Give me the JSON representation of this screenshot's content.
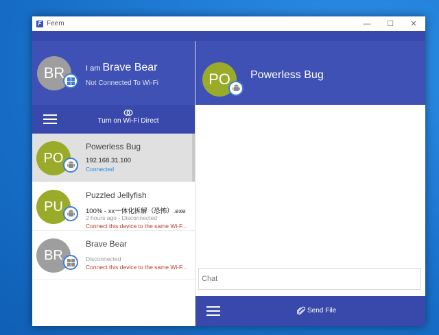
{
  "window": {
    "title": "Feem",
    "logo_letter": "F"
  },
  "me": {
    "initials": "BR",
    "name_prefix": "I am",
    "name": "Brave Bear",
    "status": "Not Connected To Wi-Fi",
    "avatar_color": "#9e9e9e",
    "os_icon": "windows-icon"
  },
  "nav": {
    "wifi_direct_label": "Turn on Wi-Fi Direct"
  },
  "devices": [
    {
      "initials": "PO",
      "name": "Powerless Bug",
      "line1": "192.168.31.100",
      "line2": "Connected",
      "line3": "",
      "avatar_color": "#9aab2a",
      "os_icon": "android-icon",
      "selected": true
    },
    {
      "initials": "PU",
      "name": "Puzzled Jellyfish",
      "line1": "100% - xx一体化拆解（恐怖）.exe",
      "line2": "2 hours ago - Disconnected",
      "line3": "Connect this device to the same Wi-F...",
      "avatar_color": "#9aab2a",
      "os_icon": "android-icon",
      "selected": false
    },
    {
      "initials": "BR",
      "name": "Brave Bear",
      "line1": "",
      "line2": "Disconnected",
      "line3": "Connect this device to the same Wi-F...",
      "avatar_color": "#9e9e9e",
      "os_icon": "windows-icon",
      "selected": false
    }
  ],
  "peer": {
    "initials": "PO",
    "name": "Powerless Bug",
    "avatar_color": "#9aab2a",
    "os_icon": "android-icon"
  },
  "chat": {
    "placeholder": "Chat"
  },
  "bottom": {
    "send_file_label": "Send File"
  },
  "colors": {
    "primary": "#3f51b5",
    "primary_dark": "#3949ab",
    "connected": "#1e88e5",
    "warning": "#c0392b"
  }
}
